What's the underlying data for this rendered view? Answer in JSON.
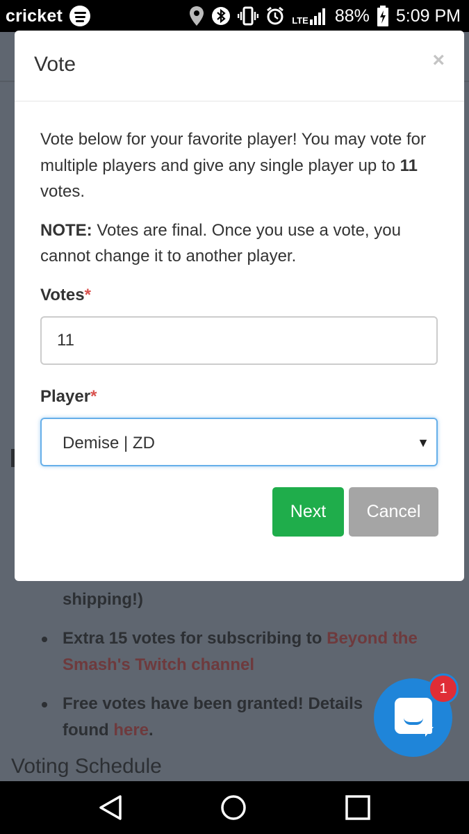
{
  "status_bar": {
    "carrier": "cricket",
    "lte_label": "LTE",
    "battery_percent": "88%",
    "time": "5:09 PM",
    "icons": [
      "spotify-icon",
      "location-icon",
      "bluetooth-icon",
      "vibrate-icon",
      "alarm-icon",
      "lte-signal-icon",
      "battery-charging-icon"
    ]
  },
  "modal": {
    "title": "Vote",
    "close_label": "×",
    "intro_prefix": "Vote below for your favorite player! You may vote for multiple players and give any single player up to ",
    "intro_max_votes": "11",
    "intro_suffix": " votes.",
    "note_label": "NOTE:",
    "note_text": " Votes are final. Once you use a vote, you cannot change it to another player.",
    "votes_label": "Votes",
    "votes_value": "11",
    "player_label": "Player",
    "player_selected": "Demise | ZD",
    "required_mark": "*",
    "next_label": "Next",
    "cancel_label": "Cancel"
  },
  "background_page": {
    "partial_line": "shipping!)",
    "bullet2_prefix": "Extra 15 votes for subscribing to ",
    "bullet2_link": "Beyond the Smash's Twitch channel",
    "bullet3_prefix": "Free votes have been granted! Details",
    "bullet3_mid": "found ",
    "bullet3_link": "here",
    "bullet3_suffix": ".",
    "heading": "Voting Schedule"
  },
  "chat_widget": {
    "unread_count": "1",
    "accent": "#1f85d9"
  },
  "nav_bar": {
    "buttons": [
      "back-icon",
      "home-icon",
      "recents-icon"
    ]
  },
  "colors": {
    "next_button": "#1fad4b",
    "cancel_button": "#a5a5a5",
    "required": "#d9534f",
    "focus_border": "#66afe9"
  }
}
